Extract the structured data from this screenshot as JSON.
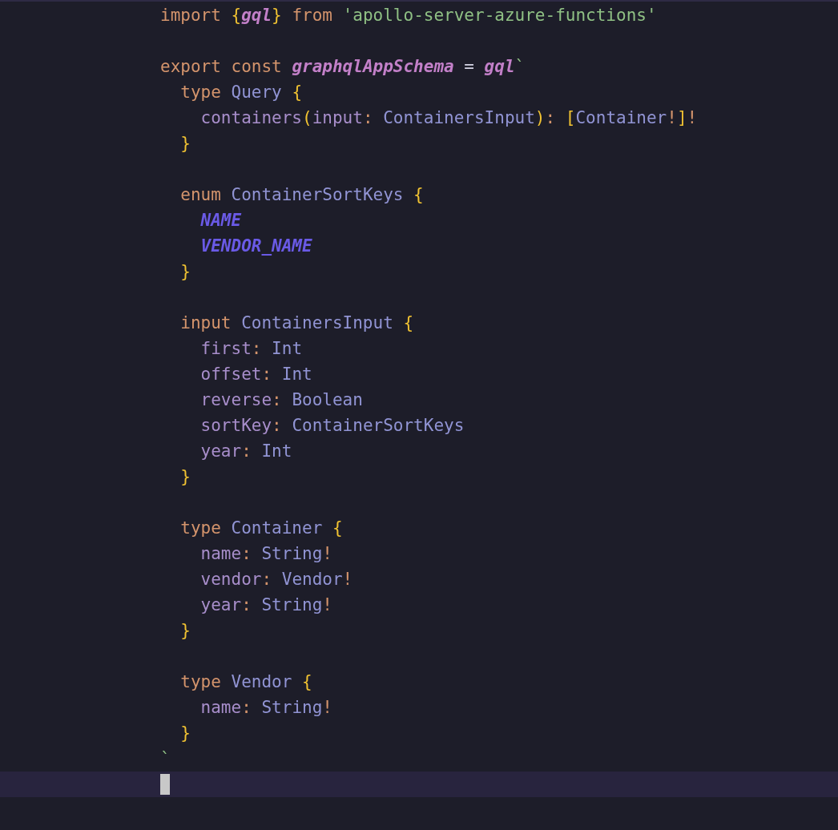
{
  "editor": {
    "lines": [
      {
        "kind": "code",
        "tokens": [
          {
            "kind": "keyword",
            "text": "import "
          },
          {
            "kind": "brace",
            "text": "{"
          },
          {
            "kind": "variable",
            "text": "gql"
          },
          {
            "kind": "brace",
            "text": "}"
          },
          {
            "kind": "keyword",
            "text": " from "
          },
          {
            "kind": "string",
            "text": "'apollo-server-azure-functions'"
          }
        ]
      },
      {
        "kind": "blank"
      },
      {
        "kind": "code",
        "tokens": [
          {
            "kind": "keyword",
            "text": "export const "
          },
          {
            "kind": "variable",
            "text": "graphqlAppSchema"
          },
          {
            "kind": "plain",
            "text": " = "
          },
          {
            "kind": "variable",
            "text": "gql"
          },
          {
            "kind": "string",
            "text": "`"
          }
        ]
      },
      {
        "kind": "code",
        "tokens": [
          {
            "kind": "keyword",
            "text": "  type "
          },
          {
            "kind": "type",
            "text": "Query "
          },
          {
            "kind": "brace",
            "text": "{"
          }
        ]
      },
      {
        "kind": "code",
        "tokens": [
          {
            "kind": "field",
            "text": "    containers"
          },
          {
            "kind": "brace",
            "text": "("
          },
          {
            "kind": "field",
            "text": "input"
          },
          {
            "kind": "punct",
            "text": ": "
          },
          {
            "kind": "type",
            "text": "ContainersInput"
          },
          {
            "kind": "brace",
            "text": ")"
          },
          {
            "kind": "punct",
            "text": ": "
          },
          {
            "kind": "brace",
            "text": "["
          },
          {
            "kind": "type",
            "text": "Container"
          },
          {
            "kind": "punct",
            "text": "!"
          },
          {
            "kind": "brace",
            "text": "]"
          },
          {
            "kind": "punct",
            "text": "!"
          }
        ]
      },
      {
        "kind": "code",
        "tokens": [
          {
            "kind": "brace",
            "text": "  }"
          }
        ]
      },
      {
        "kind": "blank"
      },
      {
        "kind": "code",
        "tokens": [
          {
            "kind": "keyword",
            "text": "  enum "
          },
          {
            "kind": "type",
            "text": "ContainerSortKeys "
          },
          {
            "kind": "brace",
            "text": "{"
          }
        ]
      },
      {
        "kind": "code",
        "tokens": [
          {
            "kind": "enum",
            "text": "    NAME"
          }
        ]
      },
      {
        "kind": "code",
        "tokens": [
          {
            "kind": "enum",
            "text": "    VENDOR_NAME"
          }
        ]
      },
      {
        "kind": "code",
        "tokens": [
          {
            "kind": "brace",
            "text": "  }"
          }
        ]
      },
      {
        "kind": "blank"
      },
      {
        "kind": "code",
        "tokens": [
          {
            "kind": "keyword",
            "text": "  input "
          },
          {
            "kind": "type",
            "text": "ContainersInput "
          },
          {
            "kind": "brace",
            "text": "{"
          }
        ]
      },
      {
        "kind": "code",
        "tokens": [
          {
            "kind": "field",
            "text": "    first"
          },
          {
            "kind": "punct",
            "text": ": "
          },
          {
            "kind": "type",
            "text": "Int"
          }
        ]
      },
      {
        "kind": "code",
        "tokens": [
          {
            "kind": "field",
            "text": "    offset"
          },
          {
            "kind": "punct",
            "text": ": "
          },
          {
            "kind": "type",
            "text": "Int"
          }
        ]
      },
      {
        "kind": "code",
        "tokens": [
          {
            "kind": "field",
            "text": "    reverse"
          },
          {
            "kind": "punct",
            "text": ": "
          },
          {
            "kind": "type",
            "text": "Boolean"
          }
        ]
      },
      {
        "kind": "code",
        "tokens": [
          {
            "kind": "field",
            "text": "    sortKey"
          },
          {
            "kind": "punct",
            "text": ": "
          },
          {
            "kind": "type",
            "text": "ContainerSortKeys"
          }
        ]
      },
      {
        "kind": "code",
        "tokens": [
          {
            "kind": "field",
            "text": "    year"
          },
          {
            "kind": "punct",
            "text": ": "
          },
          {
            "kind": "type",
            "text": "Int"
          }
        ]
      },
      {
        "kind": "code",
        "tokens": [
          {
            "kind": "brace",
            "text": "  }"
          }
        ]
      },
      {
        "kind": "blank"
      },
      {
        "kind": "code",
        "tokens": [
          {
            "kind": "keyword",
            "text": "  type "
          },
          {
            "kind": "type",
            "text": "Container "
          },
          {
            "kind": "brace",
            "text": "{"
          }
        ]
      },
      {
        "kind": "code",
        "tokens": [
          {
            "kind": "field",
            "text": "    name"
          },
          {
            "kind": "punct",
            "text": ": "
          },
          {
            "kind": "type",
            "text": "String"
          },
          {
            "kind": "punct",
            "text": "!"
          }
        ]
      },
      {
        "kind": "code",
        "tokens": [
          {
            "kind": "field",
            "text": "    vendor"
          },
          {
            "kind": "punct",
            "text": ": "
          },
          {
            "kind": "type",
            "text": "Vendor"
          },
          {
            "kind": "punct",
            "text": "!"
          }
        ]
      },
      {
        "kind": "code",
        "tokens": [
          {
            "kind": "field",
            "text": "    year"
          },
          {
            "kind": "punct",
            "text": ": "
          },
          {
            "kind": "type",
            "text": "String"
          },
          {
            "kind": "punct",
            "text": "!"
          }
        ]
      },
      {
        "kind": "code",
        "tokens": [
          {
            "kind": "brace",
            "text": "  }"
          }
        ]
      },
      {
        "kind": "blank"
      },
      {
        "kind": "code",
        "tokens": [
          {
            "kind": "keyword",
            "text": "  type "
          },
          {
            "kind": "type",
            "text": "Vendor "
          },
          {
            "kind": "brace",
            "text": "{"
          }
        ]
      },
      {
        "kind": "code",
        "tokens": [
          {
            "kind": "field",
            "text": "    name"
          },
          {
            "kind": "punct",
            "text": ": "
          },
          {
            "kind": "type",
            "text": "String"
          },
          {
            "kind": "punct",
            "text": "!"
          }
        ]
      },
      {
        "kind": "code",
        "tokens": [
          {
            "kind": "brace",
            "text": "  }"
          }
        ]
      },
      {
        "kind": "code",
        "tokens": [
          {
            "kind": "string",
            "text": "`"
          }
        ]
      },
      {
        "kind": "current"
      }
    ]
  }
}
